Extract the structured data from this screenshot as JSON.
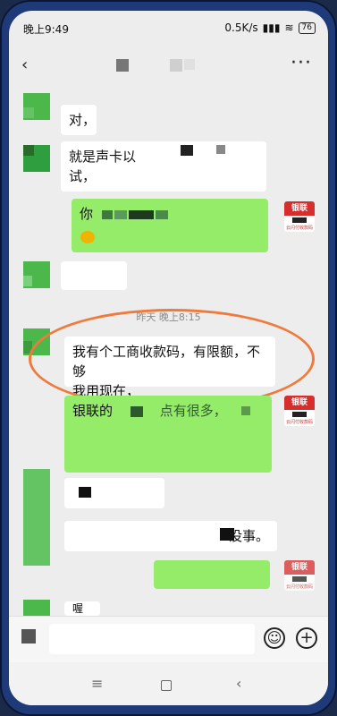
{
  "status_bar": {
    "time": "晚上9:49",
    "network_speed": "0.5K/s",
    "signal": "▮▮▮",
    "wifi": "≋",
    "battery": "76"
  },
  "title_bar": {
    "back_icon": "‹",
    "more_icon": "···"
  },
  "messages": {
    "m1": "对，",
    "m2_line1": "就是声卡以",
    "m2_line2": "试，",
    "m3": "你",
    "timestamp": "昨天 晚上8:15",
    "m4_line1": "我有个工商收款码，有限额，不够",
    "m4_line2": "我用现在，",
    "m5": "银联的",
    "m5_partial": "点有很多，",
    "m6_partial": "没事。",
    "m7_partial": "喔"
  },
  "unionpay_badge": {
    "title": "银联",
    "subtitle": "云闪付收款码"
  },
  "input_bar": {
    "emoji_icon": "☺",
    "plus_icon": "+"
  },
  "nav_bar": {
    "menu_icon": "≡",
    "back_icon": "‹"
  }
}
